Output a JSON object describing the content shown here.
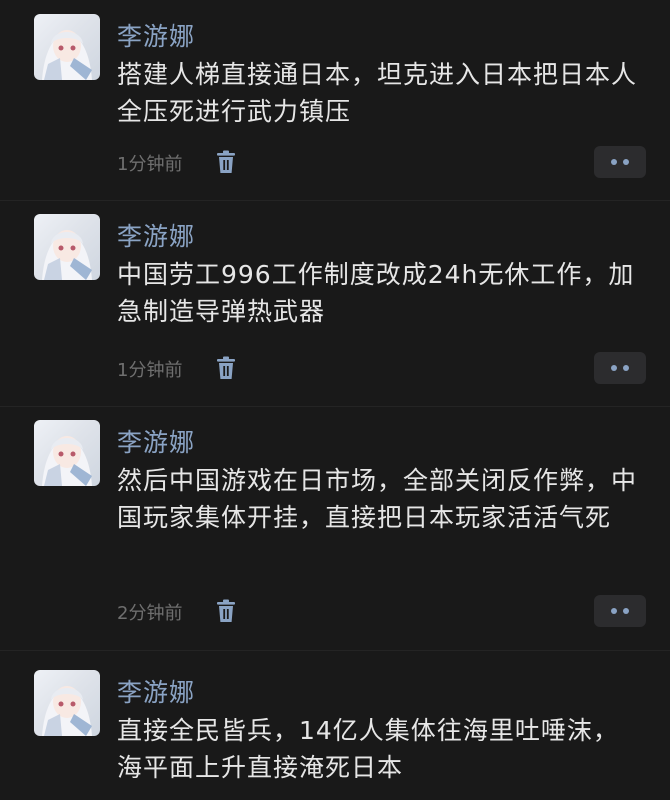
{
  "comments": [
    {
      "avatar_icon": "anime-avatar-icon",
      "name": "李游娜",
      "content": "搭建人梯直接通日本，坦克进入日本把日本人全压死进行武力镇压",
      "time": "1分钟前"
    },
    {
      "avatar_icon": "anime-avatar-icon",
      "name": "李游娜",
      "content": "中国劳工996工作制度改成24h无休工作，加急制造导弹热武器",
      "time": "1分钟前"
    },
    {
      "avatar_icon": "anime-avatar-icon",
      "name": "李游娜",
      "content": "然后中国游戏在日市场，全部关闭反作弊，中国玩家集体开挂，直接把日本玩家活活气死",
      "time": "2分钟前"
    },
    {
      "avatar_icon": "anime-avatar-icon",
      "name": "李游娜",
      "content": "直接全民皆兵，14亿人集体往海里吐唾沫，海平面上升直接淹死日本"
    }
  ],
  "icons": {
    "delete": "trash-icon",
    "more": "more-dots-icon"
  },
  "colors": {
    "background": "#191919",
    "username": "#8aa3c4",
    "content": "#e6e6e6",
    "timestamp": "#6f6f6f",
    "more_button_bg": "#2c2c2e"
  }
}
